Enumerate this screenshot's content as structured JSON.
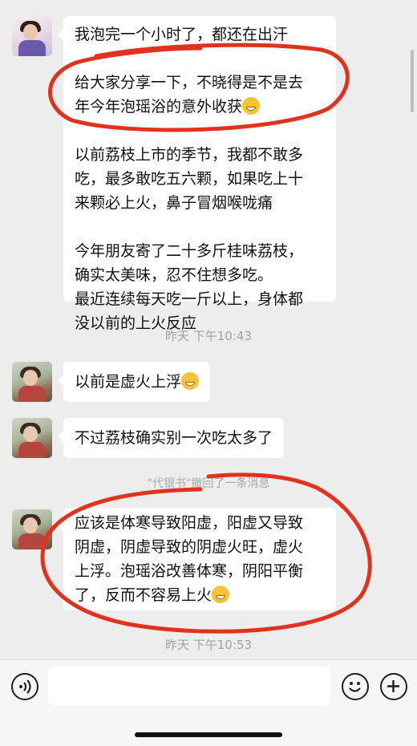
{
  "messages": [
    {
      "id": "m1",
      "paragraphs": [
        "我泡完一个小时了，都还在出汗",
        "给大家分享一下，不晓得是不是去\n年今年泡瑶浴的意外收获",
        "以前荔枝上市的季节，我都不敢多\n吃，最多敢吃五六颗，如果吃上十\n来颗必上火，鼻子冒烟喉咙痛",
        "今年朋友寄了二十多斤桂味荔枝，\n确实太美味，忍不住想多吃。\n最近连续每天吃一斤以上，身体都\n没以前的上火反应"
      ]
    },
    {
      "id": "m2",
      "text": "以前是虚火上浮"
    },
    {
      "id": "m3",
      "text": "不过荔枝确实别一次吃太多了"
    },
    {
      "id": "m4",
      "text": "应该是体寒导致阳虚，阳虚又导致\n阴虚，阴虚导致的阴虚火旺，虚火\n上浮。泡瑶浴改善体寒，阴阳平衡\n了，反而不容易上火"
    }
  ],
  "timestamps": [
    "昨天 下午10:43",
    "昨天 下午10:53"
  ],
  "recall_notice": "\"代银书\"撤回了一条消息",
  "icons": {
    "voice": "voice-icon",
    "emoji": "emoji-face-icon",
    "plus": "plus-icon",
    "grin": "grin-emoji-icon",
    "penguin": "penguin-emoji-icon"
  },
  "colors": {
    "background": "#ededed",
    "bubble": "#ffffff",
    "annotation": "#e0321f"
  }
}
